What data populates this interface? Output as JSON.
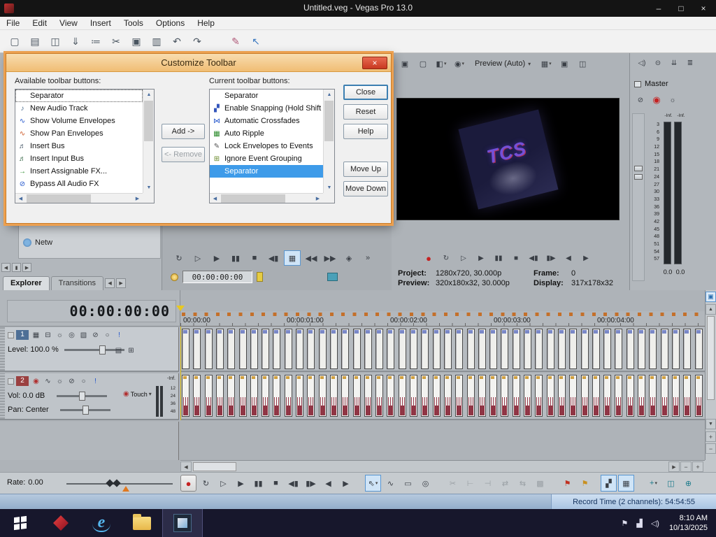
{
  "ui": {
    "caret": "▾",
    "up": "▲",
    "down": "▼",
    "left": "◀",
    "right": "▶",
    "plus": "+",
    "minus": "−",
    "pause": "▮",
    "box": "▣"
  },
  "window": {
    "title": "Untitled.veg - Vegas Pro 13.0",
    "minimize": "–",
    "restore": "□",
    "close": "×"
  },
  "menu": [
    "File",
    "Edit",
    "View",
    "Insert",
    "Tools",
    "Options",
    "Help"
  ],
  "main_toolbar": [
    {
      "name": "new-project-icon",
      "glyph": "▢"
    },
    {
      "name": "open-icon",
      "glyph": "▤"
    },
    {
      "name": "save-icon",
      "glyph": "◫"
    },
    {
      "name": "render-as-icon",
      "glyph": "⇓"
    },
    {
      "name": "properties-icon",
      "glyph": "≔"
    },
    {
      "name": "cut-icon",
      "glyph": "✂"
    },
    {
      "name": "copy-icon",
      "glyph": "▣"
    },
    {
      "name": "paste-icon",
      "glyph": "▥"
    },
    {
      "name": "undo-icon",
      "glyph": "↶"
    },
    {
      "name": "redo-icon",
      "glyph": "↷"
    },
    {
      "name": "eraser-icon",
      "glyph": "✎",
      "color": "#b05878",
      "gap": true
    },
    {
      "name": "whats-this-icon",
      "glyph": "↖",
      "color": "#3a78c0"
    }
  ],
  "explorer": {
    "network_label": "Netw",
    "tabs": [
      "Explorer",
      "Transitions"
    ]
  },
  "mid_transport": [
    {
      "name": "loop-playback-icon",
      "glyph": "↻"
    },
    {
      "name": "play-from-start-icon",
      "glyph": "▷"
    },
    {
      "name": "play-icon",
      "glyph": "▶"
    },
    {
      "name": "pause-icon",
      "glyph": "▮▮"
    },
    {
      "name": "stop-icon",
      "glyph": "■"
    },
    {
      "name": "go-to-start-icon",
      "glyph": "◀▮"
    },
    {
      "name": "loop-region-icon",
      "glyph": "▦",
      "highlight": true
    },
    {
      "name": "step-back-icon",
      "glyph": "◀◀"
    },
    {
      "name": "step-forward-icon",
      "glyph": "▶▶"
    },
    {
      "name": "audio-meters-icon",
      "glyph": "◈"
    },
    {
      "name": "overflow-icon",
      "glyph": "»"
    }
  ],
  "dialog": {
    "title": "Customize Toolbar",
    "close_glyph": "×",
    "available_label": "Available toolbar buttons:",
    "current_label": "Current toolbar buttons:",
    "available_items": [
      {
        "label": "Separator",
        "icon": "",
        "icon_name": "separator-icon",
        "focused": true
      },
      {
        "label": "New Audio Track",
        "icon": "♪",
        "icon_name": "new-audio-track-icon",
        "icon_color": "#446688"
      },
      {
        "label": "Show Volume Envelopes",
        "icon": "∿",
        "icon_name": "volume-envelope-icon",
        "icon_color": "#2255cc"
      },
      {
        "label": "Show Pan Envelopes",
        "icon": "∿",
        "icon_name": "pan-envelope-icon",
        "icon_color": "#cc5522"
      },
      {
        "label": "Insert Bus",
        "icon": "♬",
        "icon_name": "insert-bus-icon",
        "icon_color": "#445566"
      },
      {
        "label": "Insert Input Bus",
        "icon": "♬",
        "icon_name": "insert-input-bus-icon",
        "icon_color": "#336644"
      },
      {
        "label": "Insert Assignable FX...",
        "icon": "→",
        "icon_name": "insert-assignable-fx-icon",
        "icon_color": "#2a8a2a"
      },
      {
        "label": "Bypass All Audio FX",
        "icon": "⊘",
        "icon_name": "bypass-audio-fx-icon",
        "icon_color": "#2255cc"
      }
    ],
    "current_items": [
      {
        "label": "Separator",
        "icon": "",
        "icon_name": "separator-icon"
      },
      {
        "label": "Enable Snapping (Hold Shift t",
        "icon": "▞",
        "icon_name": "enable-snapping-icon",
        "icon_color": "#3355bb"
      },
      {
        "label": "Automatic Crossfades",
        "icon": "⋈",
        "icon_name": "automatic-crossfades-icon",
        "icon_color": "#2255cc"
      },
      {
        "label": "Auto Ripple",
        "icon": "▦",
        "icon_name": "auto-ripple-icon",
        "icon_color": "#2a8a2a"
      },
      {
        "label": "Lock Envelopes to Events",
        "icon": "✎",
        "icon_name": "lock-envelopes-icon",
        "icon_color": "#555555"
      },
      {
        "label": "Ignore Event Grouping",
        "icon": "⊞",
        "icon_name": "ignore-event-grouping-icon",
        "icon_color": "#6a8a2a"
      },
      {
        "label": "Separator",
        "icon": "",
        "icon_name": "separator-icon",
        "selected": true
      }
    ],
    "buttons": {
      "add": "Add ->",
      "remove": "<- Remove",
      "close": "Close",
      "reset": "Reset",
      "help": "Help",
      "move_up": "Move Up",
      "move_down": "Move Down"
    }
  },
  "preview": {
    "toolbar_icons_left": [
      {
        "name": "external-monitor-icon",
        "glyph": "▣"
      },
      {
        "name": "video-output-icon",
        "glyph": "▢"
      },
      {
        "name": "split-screen-icon",
        "glyph": "◧",
        "dropdown": true
      },
      {
        "name": "overlays-icon",
        "glyph": "◉",
        "dropdown": true
      }
    ],
    "quality_dropdown": "Preview (Auto)",
    "toolbar_icons_right": [
      {
        "name": "grid-overlay-icon",
        "glyph": "▦",
        "dropdown": true
      },
      {
        "name": "copy-frame-icon",
        "glyph": "▣"
      },
      {
        "name": "save-snapshot-icon",
        "glyph": "◫"
      }
    ],
    "overlay_text": "TCS",
    "transport": [
      {
        "name": "record-icon",
        "glyph": "●",
        "record": true
      },
      {
        "name": "loop-playback-icon",
        "glyph": "↻"
      },
      {
        "name": "play-from-start-icon",
        "glyph": "▷"
      },
      {
        "name": "play-icon",
        "glyph": "▶"
      },
      {
        "name": "pause-icon",
        "glyph": "▮▮"
      },
      {
        "name": "stop-icon",
        "glyph": "■"
      },
      {
        "name": "go-to-start-icon",
        "glyph": "◀▮"
      },
      {
        "name": "go-to-end-icon",
        "glyph": "▮▶"
      },
      {
        "name": "prev-frame-icon",
        "glyph": "◀"
      },
      {
        "name": "next-frame-icon",
        "glyph": "▶"
      }
    ],
    "info": {
      "project_label": "Project:",
      "project_value": "1280x720, 30.000p",
      "frame_label": "Frame:",
      "frame_value": "0",
      "preview_label": "Preview:",
      "preview_value": "320x180x32, 30.000p",
      "display_label": "Display:",
      "display_value": "317x178x32"
    }
  },
  "master": {
    "top_icons": [
      {
        "name": "mute-output-icon",
        "glyph": "◁)"
      },
      {
        "name": "dim-output-icon",
        "glyph": "⊝"
      },
      {
        "name": "downmix-output-icon",
        "glyph": "⇊"
      },
      {
        "name": "meter-options-icon",
        "glyph": "≣"
      }
    ],
    "label": "Master",
    "sub_icons": [
      {
        "name": "master-mute-icon",
        "glyph": "⊘"
      },
      {
        "name": "master-record-icon",
        "glyph": "◉",
        "record": true
      },
      {
        "name": "master-fx-icon",
        "glyph": "☼"
      }
    ],
    "meter_top_left": "-Inf.",
    "meter_top_right": "-Inf.",
    "scale": [
      "3",
      "6",
      "9",
      "12",
      "15",
      "18",
      "21",
      "24",
      "27",
      "30",
      "33",
      "36",
      "39",
      "42",
      "45",
      "48",
      "51",
      "54",
      "57"
    ],
    "value_left": "0.0",
    "value_right": "0.0"
  },
  "timeline": {
    "big_timecode": "00:00:00:00",
    "cursor_timecode": "00:00:00:00",
    "ruler_labels": [
      "00:00:00",
      "00:00:01:00",
      "00:00:02:00",
      "00:00:03:00",
      "00:00:04:00"
    ],
    "clip_count": 46
  },
  "track1": {
    "number": "1",
    "level_label": "Level:",
    "level_value": "100.0 %",
    "icons": [
      {
        "name": "compositing-mode-icon",
        "glyph": "▦"
      },
      {
        "name": "make-compositing-child-icon",
        "glyph": "⊟"
      },
      {
        "name": "track-fx-icon",
        "glyph": "☼"
      },
      {
        "name": "track-motion-icon",
        "glyph": "◎"
      },
      {
        "name": "bypass-motion-blur-icon",
        "glyph": "▧"
      },
      {
        "name": "mute-icon",
        "glyph": "⊘"
      },
      {
        "name": "solo-icon",
        "glyph": "○"
      },
      {
        "name": "automation-settings-icon",
        "glyph": "!",
        "color": "#2255cc"
      }
    ],
    "right_icons": [
      {
        "name": "track-view-icon",
        "glyph": "▤"
      },
      {
        "name": "edit-details-icon",
        "glyph": "⊞"
      }
    ]
  },
  "track2": {
    "number": "2",
    "vol_label": "Vol:",
    "vol_value": "0.0 dB",
    "pan_label": "Pan:",
    "pan_value": "Center",
    "automation_label": "Touch",
    "knob_glyph": "◉",
    "meter_top": "-Inf.",
    "meter_scale": [
      "12",
      "24",
      "36",
      "48"
    ],
    "icons": [
      {
        "name": "arm-for-record-icon",
        "glyph": "◉",
        "color": "#b03030"
      },
      {
        "name": "invert-track-phase-icon",
        "glyph": "∿"
      },
      {
        "name": "track-fx-icon",
        "glyph": "☼"
      },
      {
        "name": "mute-icon",
        "glyph": "⊘"
      },
      {
        "name": "solo-icon",
        "glyph": "○"
      },
      {
        "name": "automation-settings-icon",
        "glyph": "!",
        "color": "#2255cc"
      }
    ]
  },
  "rate": {
    "label": "Rate:",
    "value": "0.00"
  },
  "bottom_transport_left": [
    {
      "name": "record-icon",
      "glyph": "●",
      "record": true
    },
    {
      "name": "loop-playback-icon",
      "glyph": "↻"
    },
    {
      "name": "play-from-start-icon",
      "glyph": "▷"
    },
    {
      "name": "play-icon",
      "glyph": "▶"
    },
    {
      "name": "pause-icon",
      "glyph": "▮▮"
    },
    {
      "name": "stop-icon",
      "glyph": "■"
    },
    {
      "name": "go-to-start-icon",
      "glyph": "◀▮"
    },
    {
      "name": "go-to-end-icon",
      "glyph": "▮▶"
    },
    {
      "name": "prev-frame-icon",
      "glyph": "◀"
    },
    {
      "name": "next-frame-icon",
      "glyph": "▶"
    },
    {
      "name": "normal-edit-tool-icon",
      "glyph": "⇖",
      "highlight": true,
      "dropdown": true,
      "gap": true
    },
    {
      "name": "envelope-edit-tool-icon",
      "glyph": "∿"
    },
    {
      "name": "selection-edit-tool-icon",
      "glyph": "▭"
    },
    {
      "name": "zoom-edit-tool-icon",
      "glyph": "◎"
    },
    {
      "name": "split-icon",
      "glyph": "✂",
      "disabled": true,
      "gap": true
    },
    {
      "name": "trim-start-icon",
      "glyph": "⊢",
      "disabled": true
    },
    {
      "name": "trim-end-icon",
      "glyph": "⊣",
      "disabled": true
    },
    {
      "name": "slip-icon",
      "glyph": "⇄",
      "disabled": true
    },
    {
      "name": "slide-icon",
      "glyph": "⇆",
      "disabled": true
    },
    {
      "name": "lock-event-icon",
      "glyph": "▩",
      "disabled": true
    },
    {
      "name": "insert-marker-icon",
      "glyph": "⚑",
      "color": "#c03020",
      "gap": true
    },
    {
      "name": "insert-region-icon",
      "glyph": "⚑",
      "color": "#c89020"
    }
  ],
  "bottom_transport_right": [
    {
      "name": "enable-snapping-icon",
      "glyph": "▞",
      "highlight": true
    },
    {
      "name": "quantize-to-frames-icon",
      "glyph": "▦",
      "highlight": true
    },
    {
      "name": "automation-settings-icon",
      "glyph": "+",
      "dropdown": true,
      "color": "#1a7a8a",
      "gap": true
    },
    {
      "name": "mixing-console-icon",
      "glyph": "◫",
      "color": "#1a7a8a"
    },
    {
      "name": "video-scopes-icon",
      "glyph": "⊕",
      "color": "#1a7a8a"
    }
  ],
  "status": {
    "record_time": "Record Time (2 channels): 54:54:55"
  },
  "taskbar": {
    "apps": [
      {
        "name": "start-button",
        "kind": "start"
      },
      {
        "name": "taskbar-vegas-shortcut",
        "kind": "vegas"
      },
      {
        "name": "taskbar-browser",
        "kind": "ie",
        "glyph": "e"
      },
      {
        "name": "taskbar-file-explorer",
        "kind": "folder"
      },
      {
        "name": "taskbar-vegas-pro",
        "kind": "vpro",
        "active": true
      }
    ],
    "tray": [
      {
        "name": "action-center-flag-icon",
        "glyph": "⚑"
      },
      {
        "name": "network-icon",
        "glyph": "▟"
      },
      {
        "name": "volume-icon",
        "glyph": "◁)"
      }
    ],
    "time": "8:10 AM",
    "date": "10/13/2025"
  }
}
